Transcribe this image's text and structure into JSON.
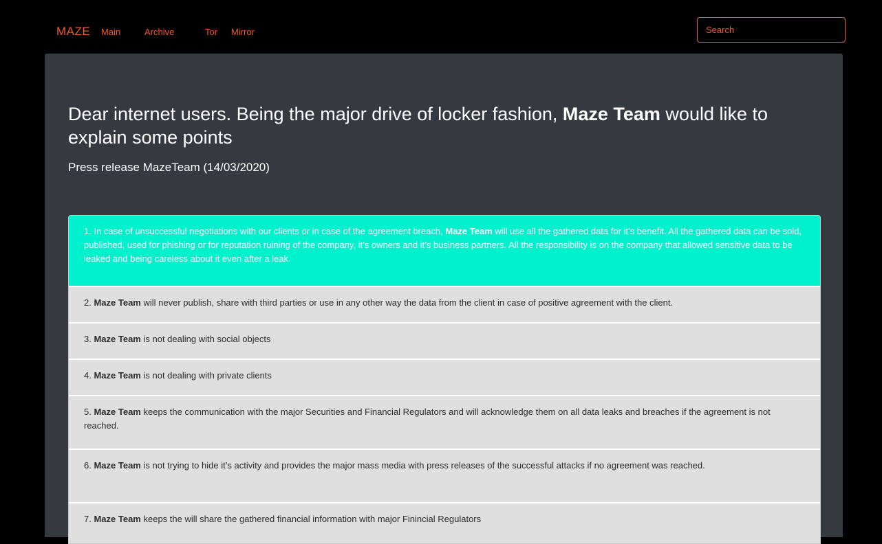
{
  "nav": {
    "brand": "MAZE",
    "links": [
      "Main",
      "Archive",
      "Tor",
      "Mirror"
    ],
    "search_placeholder": "Search"
  },
  "hero": {
    "title_before": "Dear internet users. Being the major drive of locker fashion, ",
    "title_bold": "Maze Team",
    "title_after": " would like to explain some points",
    "subtitle": "Press release MazeTeam (14/03/2020)"
  },
  "points": [
    {
      "before": "1. In case of unsuccessful negotiations with our clients or in case of the agreement breach, ",
      "bold": "Maze Team",
      "after": " will use all the gathered data for it’s benefit. All the gathered data can be sold, published, used for phishing or for reputation ruining of the company, it’s owners and it’s business partners. All the responsibility is on the company that allowed sensitive data to be leaked and being careless about it even after a leak.",
      "active": true
    },
    {
      "before": "2. ",
      "bold": "Maze Team",
      "after": " will never publish, share with third parties or use in any other way the data from the client in case of positive agreement with the client.",
      "active": false
    },
    {
      "before": "3. ",
      "bold": "Maze Team",
      "after": " is not dealing with social objects",
      "active": false
    },
    {
      "before": "4. ",
      "bold": "Maze Team",
      "after": " is not dealing with private clients",
      "active": false
    },
    {
      "before": "5. ",
      "bold": "Maze Team",
      "after": " keeps the communication with the major Securities and Financial Regulators and will acknowledge them on all data leaks and breaches if the agreement is not reached.",
      "active": false
    },
    {
      "before": "6. ",
      "bold": "Maze Team",
      "after": " is not trying to hide it’s activity and provides the major mass media with press releases of the successful attacks if no agreement was reached.",
      "active": false
    },
    {
      "before": "7. ",
      "bold": "Maze Team",
      "after": " keeps the will share the gathered financial information with major Finincial Regulators",
      "active": false
    }
  ],
  "colors": {
    "accent": "#f15a24",
    "panel": "#343a40",
    "active_item": "#00f2cd",
    "item": "#e0dfdf"
  }
}
